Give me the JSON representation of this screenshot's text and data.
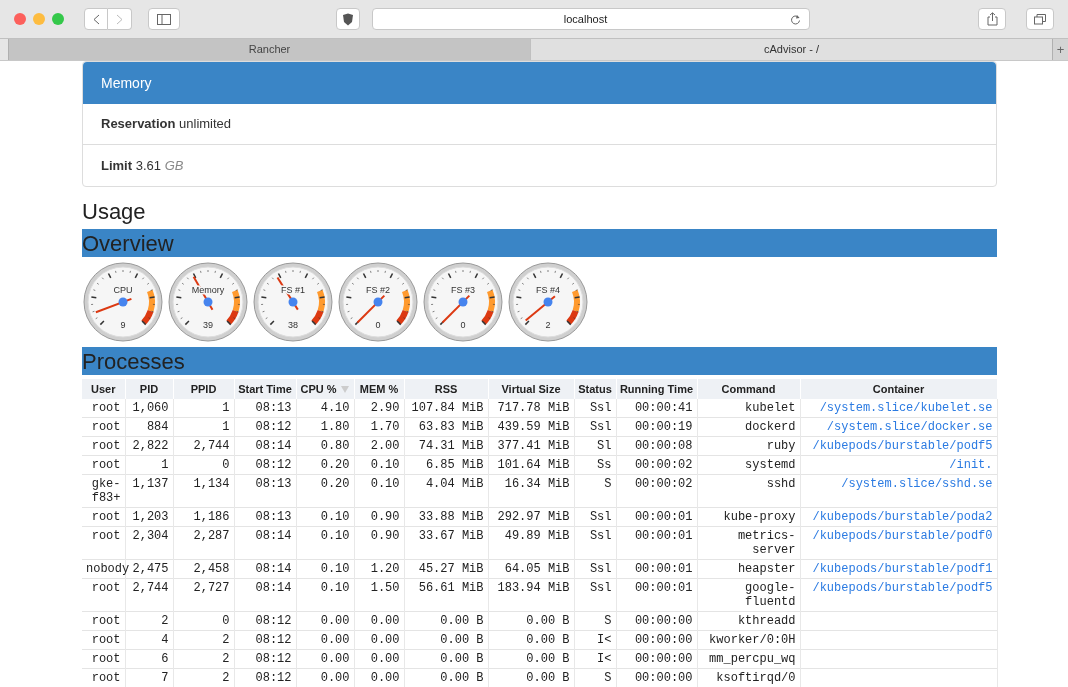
{
  "browser": {
    "address": "localhost",
    "tabs": [
      {
        "label": "Rancher",
        "selected": false
      },
      {
        "label": "cAdvisor - /",
        "selected": true
      }
    ],
    "new_tab": "+"
  },
  "memory": {
    "title": "Memory",
    "reservation": {
      "label": "Reservation",
      "value": "unlimited"
    },
    "limit": {
      "label": "Limit",
      "value": "3.61",
      "unit": "GB"
    }
  },
  "usage_title": "Usage",
  "overview": {
    "title": "Overview",
    "gauges": [
      {
        "label": "CPU",
        "value": "9"
      },
      {
        "label": "Memory",
        "value": "39"
      },
      {
        "label": "FS #1",
        "value": "38"
      },
      {
        "label": "FS #2",
        "value": "0"
      },
      {
        "label": "FS #3",
        "value": "0"
      },
      {
        "label": "FS #4",
        "value": "2"
      }
    ]
  },
  "processes": {
    "title": "Processes",
    "columns": [
      {
        "label": "User",
        "sorted": false
      },
      {
        "label": "PID",
        "sorted": false
      },
      {
        "label": "PPID",
        "sorted": false
      },
      {
        "label": "Start Time",
        "sorted": false
      },
      {
        "label": "CPU %",
        "sorted": true
      },
      {
        "label": "MEM %",
        "sorted": false
      },
      {
        "label": "RSS",
        "sorted": false
      },
      {
        "label": "Virtual Size",
        "sorted": false
      },
      {
        "label": "Status",
        "sorted": false
      },
      {
        "label": "Running Time",
        "sorted": false
      },
      {
        "label": "Command",
        "sorted": false
      },
      {
        "label": "Container",
        "sorted": false
      }
    ],
    "rows": [
      [
        "root",
        "1,060",
        "1",
        "08:13",
        "4.10",
        "2.90",
        "107.84 MiB",
        "717.78 MiB",
        "Ssl",
        "00:00:41",
        "kubelet",
        "/system.slice/kubelet.se"
      ],
      [
        "root",
        "884",
        "1",
        "08:12",
        "1.80",
        "1.70",
        "63.83 MiB",
        "439.59 MiB",
        "Ssl",
        "00:00:19",
        "dockerd",
        "/system.slice/docker.se"
      ],
      [
        "root",
        "2,822",
        "2,744",
        "08:14",
        "0.80",
        "2.00",
        "74.31 MiB",
        "377.41 MiB",
        "Sl",
        "00:00:08",
        "ruby",
        "/kubepods/burstable/podf5"
      ],
      [
        "root",
        "1",
        "0",
        "08:12",
        "0.20",
        "0.10",
        "6.85 MiB",
        "101.64 MiB",
        "Ss",
        "00:00:02",
        "systemd",
        "/init."
      ],
      [
        "gke-f83+",
        "1,137",
        "1,134",
        "08:13",
        "0.20",
        "0.10",
        "4.04 MiB",
        "16.34 MiB",
        "S",
        "00:00:02",
        "sshd",
        "/system.slice/sshd.se"
      ],
      [
        "root",
        "1,203",
        "1,186",
        "08:13",
        "0.10",
        "0.90",
        "33.88 MiB",
        "292.97 MiB",
        "Ssl",
        "00:00:01",
        "kube-proxy",
        "/kubepods/burstable/poda2"
      ],
      [
        "root",
        "2,304",
        "2,287",
        "08:14",
        "0.10",
        "0.90",
        "33.67 MiB",
        "49.89 MiB",
        "Ssl",
        "00:00:01",
        "metrics-server",
        "/kubepods/burstable/podf0"
      ],
      [
        "nobody",
        "2,475",
        "2,458",
        "08:14",
        "0.10",
        "1.20",
        "45.27 MiB",
        "64.05 MiB",
        "Ssl",
        "00:00:01",
        "heapster",
        "/kubepods/burstable/podf1"
      ],
      [
        "root",
        "2,744",
        "2,727",
        "08:14",
        "0.10",
        "1.50",
        "56.61 MiB",
        "183.94 MiB",
        "Ssl",
        "00:00:01",
        "google-fluentd",
        "/kubepods/burstable/podf5"
      ],
      [
        "root",
        "2",
        "0",
        "08:12",
        "0.00",
        "0.00",
        "0.00 B",
        "0.00 B",
        "S",
        "00:00:00",
        "kthreadd"
      ],
      [
        "root",
        "4",
        "2",
        "08:12",
        "0.00",
        "0.00",
        "0.00 B",
        "0.00 B",
        "I<",
        "00:00:00",
        "kworker/0:0H"
      ],
      [
        "root",
        "6",
        "2",
        "08:12",
        "0.00",
        "0.00",
        "0.00 B",
        "0.00 B",
        "I<",
        "00:00:00",
        "mm_percpu_wq"
      ],
      [
        "root",
        "7",
        "2",
        "08:12",
        "0.00",
        "0.00",
        "0.00 B",
        "0.00 B",
        "S",
        "00:00:00",
        "ksoftirqd/0"
      ]
    ]
  }
}
